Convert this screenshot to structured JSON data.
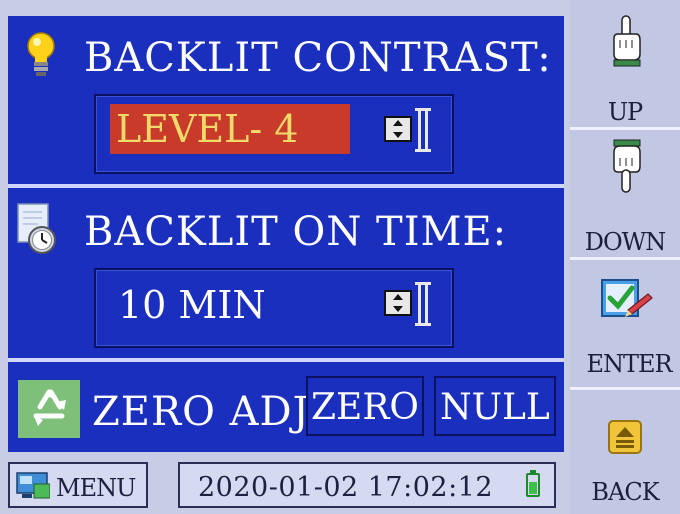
{
  "contrast": {
    "title": "BACKLIT CONTRAST:",
    "value": "LEVEL- 4"
  },
  "on_time": {
    "title": "BACKLIT ON TIME:",
    "value": "10 MIN"
  },
  "zero_adj": {
    "title": "ZERO ADJ",
    "zero_label": "ZERO",
    "null_label": "NULL"
  },
  "side_buttons": {
    "up": "UP",
    "down": "DOWN",
    "enter": "ENTER",
    "back": "BACK"
  },
  "status": {
    "menu": "MENU",
    "datetime": "2020-01-02 17:02:12"
  },
  "colors": {
    "panel": "#1b2fbf",
    "highlight": "#c83a2a",
    "highlight_text": "#f2d96a"
  }
}
